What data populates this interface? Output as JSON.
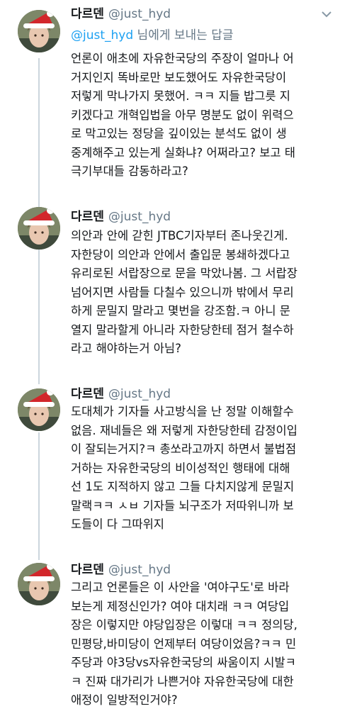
{
  "tweets": [
    {
      "name": "다르덴",
      "handle": "@just_hyd",
      "reply_to": {
        "mention": "@just_hyd",
        "suffix": " 님에게 보내는 답글"
      },
      "lines": [
        "언론이 애초에 자유한국당의 주장이 얼마나 어",
        "거지인지 똑바로만 보도했어도 자유한국당이",
        "저렇게 막나가지 못했어. ㅋㅋ 지들 밥그릇 지",
        "키겠다고 개혁입법을 아무 명분도 없이 위력으",
        "로 막고있는 정당을 깊이있는 분석도 없이 생",
        "중계해주고 있는게 실화냐? 어쩌라고? 보고 태",
        "극기부대들 감동하라고?"
      ]
    },
    {
      "name": "다르덴",
      "handle": "@just_hyd",
      "lines": [
        "의안과 안에 갇힌 JTBC기자부터 존나웃긴게.",
        "자한당이 의안과 안에서 출입문 봉쇄하겠다고",
        "유리로된 서랍장으로 문을 막았나봄. 그 서랍장",
        "넘어지면 사람들 다칠수 있으니까 밖에서 무리",
        "하게 문밀지 말라고 몇번을 강조함.ㅋ 아니 문",
        "열지 말라할게 아니라 자한당한테 점거 철수하",
        "라고 해야하는거 아님?"
      ]
    },
    {
      "name": "다르덴",
      "handle": "@just_hyd",
      "lines": [
        "도대체가 기자들 사고방식을 난 정말 이해할수",
        "없음. 재네들은 왜 저렇게 자한당한테 감정이입",
        "이 잘되는거지?ㅋ 총쏘라고까지 하면서 불법점",
        "거하는 자유한국당의 비이성적인 행태에 대해",
        "선 1도 지적하지 않고 그들 다치지않게 문밀지",
        "말랙ㅋㅋ ㅅㅂ 기자들 뇌구조가 저따위니까 보",
        "도들이 다 그따위지"
      ]
    },
    {
      "name": "다르덴",
      "handle": "@just_hyd",
      "lines": [
        "그리고 언론들은 이 사안을 '여야구도'로 바라",
        "보는게 제정신인가? 여야 대치래 ㅋㅋ 여당입",
        "장은 이렇지만 야당입장은 이렇대 ㅋㅋ 정의당,",
        "민평당,바미당이 언제부터 여당이었음?ㅋㅋ 민",
        "주당과 야3당vs자유한국당의 싸움이지 시발ㅋ",
        "ㅋ 진짜 대가리가 나쁜거야 자유한국당에 대한",
        "애정이 일방적인거야?"
      ]
    }
  ],
  "icons": {
    "avatar": "avatar-santa-hat",
    "caret": "chevron-down-icon"
  },
  "colors": {
    "name": "#14171a",
    "handle": "#657786",
    "mention": "#1da1f2",
    "thread_line": "#ccd6dd"
  }
}
